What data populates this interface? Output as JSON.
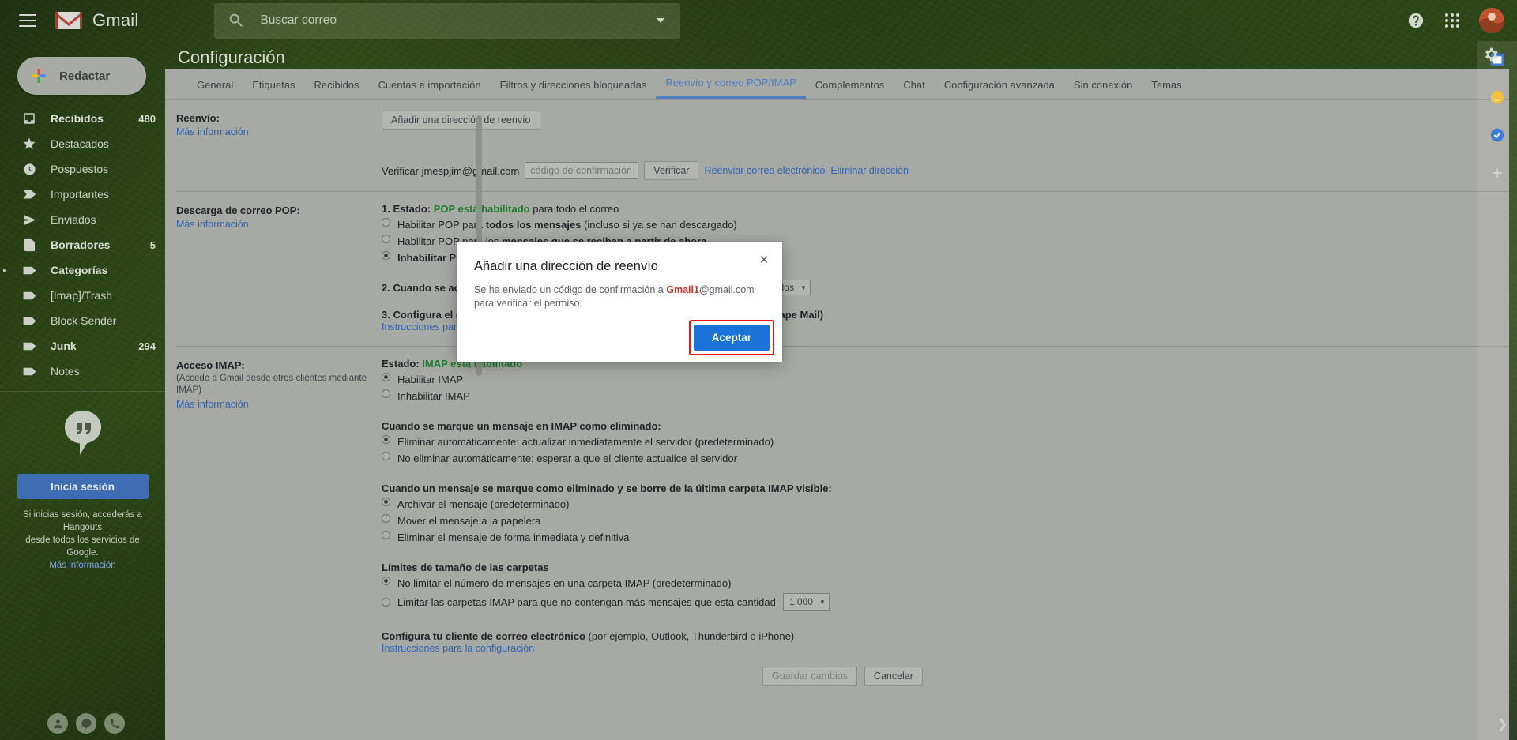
{
  "header": {
    "brand": "Gmail",
    "menu_icon": "hamburger-icon",
    "logo_icon": "gmail-logo-icon",
    "search": {
      "placeholder": "Buscar correo",
      "value": "",
      "icon": "search-icon",
      "options_icon": "chevron-down-icon"
    },
    "help_icon": "help-circle-icon",
    "apps_icon": "google-apps-grid-icon",
    "avatar_icon": "user-avatar"
  },
  "sidebar": {
    "compose": {
      "label": "Redactar",
      "icon": "plus-icon"
    },
    "items": [
      {
        "label": "Recibidos",
        "count": "480",
        "icon": "inbox-icon",
        "bold": true,
        "expander": false
      },
      {
        "label": "Destacados",
        "count": "",
        "icon": "star-icon",
        "bold": false,
        "expander": false
      },
      {
        "label": "Pospuestos",
        "count": "",
        "icon": "clock-icon",
        "bold": false,
        "expander": false
      },
      {
        "label": "Importantes",
        "count": "",
        "icon": "important-chevron-icon",
        "bold": false,
        "expander": false
      },
      {
        "label": "Enviados",
        "count": "",
        "icon": "send-icon",
        "bold": false,
        "expander": false
      },
      {
        "label": "Borradores",
        "count": "5",
        "icon": "draft-file-icon",
        "bold": true,
        "expander": false
      },
      {
        "label": "Categorías",
        "count": "",
        "icon": "label-tag-icon",
        "bold": true,
        "expander": true
      },
      {
        "label": "[Imap]/Trash",
        "count": "",
        "icon": "label-tag-icon",
        "bold": false,
        "expander": false
      },
      {
        "label": "Block Sender",
        "count": "",
        "icon": "label-tag-icon",
        "bold": false,
        "expander": false
      },
      {
        "label": "Junk",
        "count": "294",
        "icon": "label-tag-icon",
        "bold": true,
        "expander": false
      },
      {
        "label": "Notes",
        "count": "",
        "icon": "label-tag-icon",
        "bold": false,
        "expander": false
      }
    ],
    "hangouts": {
      "logo_icon": "hangouts-quote-icon",
      "signin_label": "Inicia sesión",
      "description_line1": "Si inicias sesión, accederás a Hangouts",
      "description_line2": "desde todos los servicios de Google.",
      "more_link": "Más información"
    },
    "footer_icons": [
      "contacts-person-icon",
      "hangouts-chat-icon",
      "phone-icon"
    ]
  },
  "page": {
    "title": "Configuración",
    "gear_icon": "gear-icon",
    "tabs": [
      {
        "label": "General",
        "active": false
      },
      {
        "label": "Etiquetas",
        "active": false
      },
      {
        "label": "Recibidos",
        "active": false
      },
      {
        "label": "Cuentas e importación",
        "active": false
      },
      {
        "label": "Filtros y direcciones bloqueadas",
        "active": false
      },
      {
        "label": "Reenvío y correo POP/IMAP",
        "active": true
      },
      {
        "label": "Complementos",
        "active": false
      },
      {
        "label": "Chat",
        "active": false
      },
      {
        "label": "Configuración avanzada",
        "active": false
      },
      {
        "label": "Sin conexión",
        "active": false
      },
      {
        "label": "Temas",
        "active": false
      }
    ]
  },
  "settings": {
    "forwarding": {
      "label": "Reenvío:",
      "more_link": "Más información",
      "add_button": "Añadir una dirección de reenvío",
      "verify_text": "Verificar jmespjim@gmail.com",
      "code_placeholder": "código de confirmación",
      "verify_button": "Verificar",
      "resend_link": "Reenviar correo electrónico",
      "remove_link": "Eliminar dirección"
    },
    "pop": {
      "label": "Descarga de correo POP:",
      "more_link": "Más información",
      "status_prefix": "1. Estado:",
      "status_value": "POP está habilitado",
      "status_suffix": "para todo el correo",
      "opt1_pre": "Habilitar POP para ",
      "opt1_bold": "todos los mensajes",
      "opt1_post": " (incluso si ya se han descargado)",
      "opt2_pre": "Habilitar POP para los ",
      "opt2_bold": "mensajes que se reciban a partir de ahora",
      "opt3_bold": "Inhabilitar",
      "opt3_post": " POP",
      "step2": "2. Cuando se accede a los mensajes con POP",
      "step2_select": "conservar la copia de Gmail en Recibidos",
      "step3": "3. Configura el cliente de correo electrónico (por ejemplo, Outlook, Eudora, Netscape Mail)",
      "step3_link": "Instrucciones para la configuración"
    },
    "imap": {
      "label": "Acceso IMAP:",
      "sub": "(Accede a Gmail desde otros clientes mediante IMAP)",
      "more_link": "Más información",
      "status_prefix": "Estado:",
      "status_value": "IMAP está habilitado",
      "opt1": "Habilitar IMAP",
      "opt2": "Inhabilitar IMAP",
      "deleted_heading": "Cuando se marque un mensaje en IMAP como eliminado:",
      "deleted_opt1": "Eliminar automáticamente: actualizar inmediatamente el servidor (predeterminado)",
      "deleted_opt2": "No eliminar automáticamente: esperar a que el cliente actualice el servidor",
      "expunge_heading": "Cuando un mensaje se marque como eliminado y se borre de la última carpeta IMAP visible:",
      "expunge_opt1": "Archivar el mensaje (predeterminado)",
      "expunge_opt2": "Mover el mensaje a la papelera",
      "expunge_opt3": "Eliminar el mensaje de forma inmediata y definitiva",
      "limits_heading": "Límites de tamaño de las carpetas",
      "limits_opt1": "No limitar el número de mensajes en una carpeta IMAP (predeterminado)",
      "limits_opt2": "Limitar las carpetas IMAP para que no contengan más mensajes que esta cantidad",
      "limits_select": "1.000",
      "client_pre": "Configura tu cliente de correo electrónico",
      "client_post": "(por ejemplo, Outlook, Thunderbird o iPhone)",
      "client_link": "Instrucciones para la configuración"
    },
    "save_label": "Guardar cambios",
    "cancel_label": "Cancelar"
  },
  "dialog": {
    "title": "Añadir una dirección de reenvío",
    "close_icon": "close-icon",
    "body_pre": "Se ha enviado un código de confirmación a",
    "body_highlight": "Gmail1",
    "body_mid": "@gmail.com para",
    "body_post": "verificar el permiso.",
    "accept_label": "Aceptar",
    "highlight_color": "#c0392b",
    "accept_bg": "#1a73d9",
    "accept_outline": "#e8170f"
  },
  "right_rail": {
    "icons": [
      "calendar-icon",
      "keep-note-icon",
      "tasks-icon",
      "add-plus-icon"
    ],
    "expand_icon": "chevron-right-icon"
  }
}
